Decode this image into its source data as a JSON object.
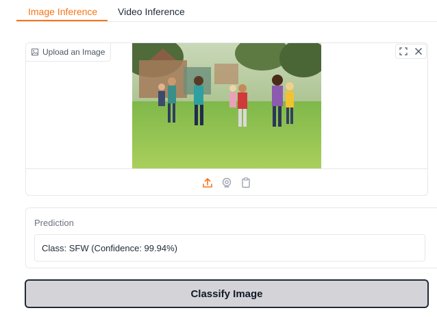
{
  "tabs": [
    {
      "label": "Image Inference",
      "active": true
    },
    {
      "label": "Video Inference",
      "active": false
    }
  ],
  "image_panel": {
    "label": "Upload an Image",
    "corner_icons": [
      "fullscreen-icon",
      "close-icon"
    ],
    "source_icons": [
      "upload-icon",
      "webcam-icon",
      "clipboard-icon"
    ],
    "image_alt": "Children running on a grass field in a park"
  },
  "prediction": {
    "label": "Prediction",
    "value": "Class: SFW (Confidence: 99.94%)"
  },
  "classify_button": {
    "label": "Classify Image"
  },
  "colors": {
    "accent": "#f97316",
    "border": "#e5e7eb",
    "button_bg": "#d4d4d8"
  }
}
